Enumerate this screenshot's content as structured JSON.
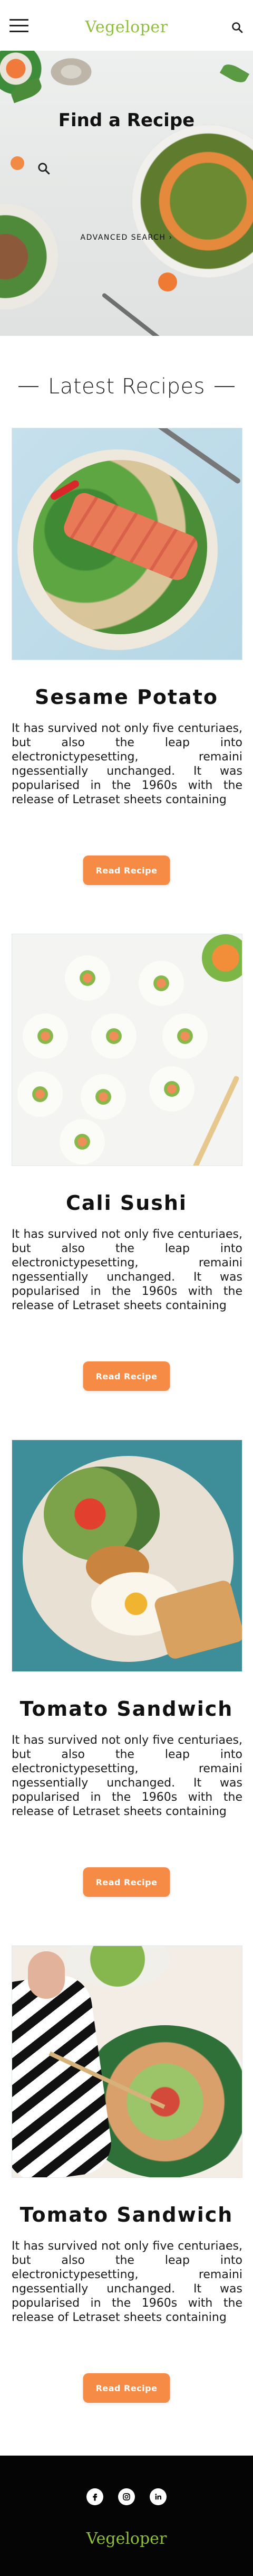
{
  "header": {
    "logo": "Vegeloper",
    "menu_icon": "hamburger-menu-icon",
    "search_icon": "search-icon"
  },
  "hero": {
    "title": "Find a Recipe",
    "search_placeholder": "",
    "advanced_search": "ADVANCED SEARCH",
    "advanced_search_arrow": "›"
  },
  "section": {
    "title": "Latest Recipes"
  },
  "recipes": [
    {
      "title": "Sesame Potato",
      "description": "It has survived not only five centuriaes, but also the leap into electronictypesetting, remaini ngessentially unchanged. It was popularised in the 1960s with the release of Letraset sheets containing",
      "button": "Read Recipe"
    },
    {
      "title": "Cali Sushi",
      "description": "It has survived not only five centuriaes, but also the leap into electronictypesetting, remaini ngessentially unchanged. It was popularised in the 1960s with the release of Letraset sheets containing",
      "button": "Read Recipe"
    },
    {
      "title": "Tomato Sandwich",
      "description": "It has survived not only five centuriaes, but also the leap into electronictypesetting, remaini ngessentially unchanged. It was popularised in the 1960s with the release of Letraset sheets containing",
      "button": "Read Recipe"
    },
    {
      "title": "Tomato Sandwich",
      "description": "It has survived not only five centuriaes, but also the leap into electronictypesetting, remaini ngessentially unchanged. It was popularised in the 1960s with the release of Letraset sheets containing",
      "button": "Read Recipe"
    }
  ],
  "footer": {
    "logo": "Vegeloper",
    "social": [
      "facebook-icon",
      "instagram-icon",
      "linkedin-icon"
    ]
  },
  "colors": {
    "brand_green": "#8fbf3f",
    "button_orange": "#f68b45",
    "footer_bg": "#050505"
  }
}
